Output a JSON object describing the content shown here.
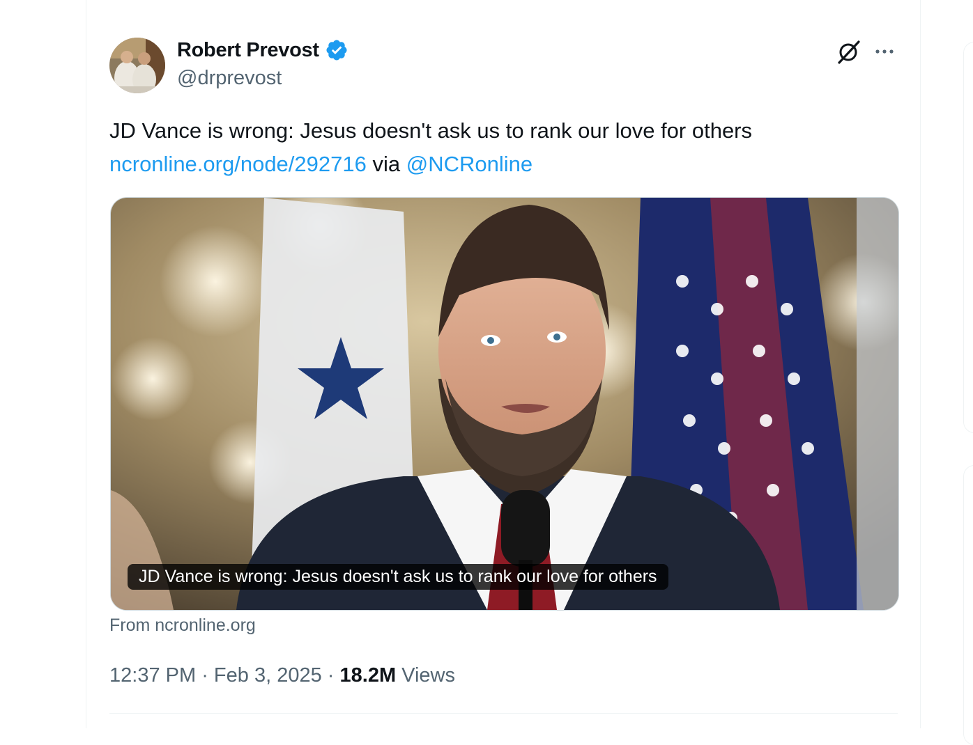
{
  "tweet": {
    "author_name": "Robert Prevost",
    "author_handle": "@drprevost",
    "text": "JD Vance is wrong: Jesus doesn't ask us to rank our love for others",
    "link_text": "ncronline.org/node/292716",
    "via_text": " via ",
    "mention": "@NCRonline",
    "media_caption": "JD Vance is wrong: Jesus doesn't ask us to rank our love for others",
    "source_line": "From ncronline.org",
    "time": "12:37 PM",
    "separator": " · ",
    "date": "Feb 3, 2025",
    "views_count": "18.2M",
    "views_label": " Views"
  },
  "icons": {
    "verified": "verified-badge-icon",
    "grok": "grok-icon",
    "more": "more-options-icon"
  },
  "colors": {
    "link": "#1d9bf0",
    "secondary_text": "#536471",
    "primary_text": "#0f1419",
    "verified": "#1d9bf0"
  }
}
